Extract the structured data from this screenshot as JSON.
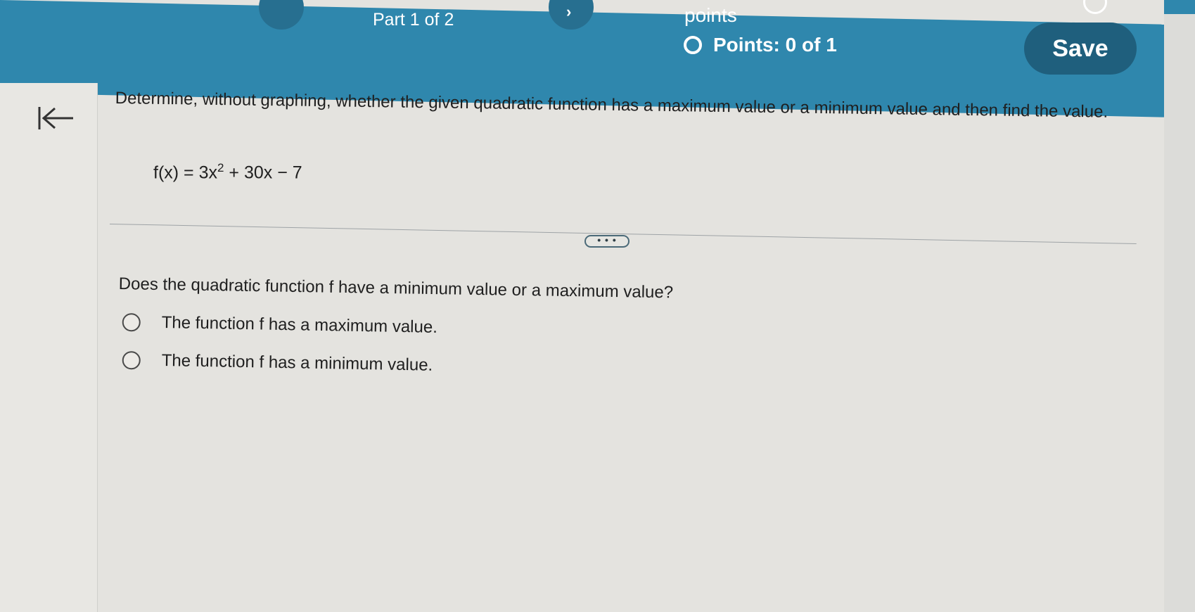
{
  "header": {
    "part_label": "Part 1 of 2",
    "next_icon": "chevron-right",
    "points_word": "points",
    "points_status": "Points: 0 of 1",
    "save_label": "Save"
  },
  "nav": {
    "back_icon": "arrow-left-to-bar"
  },
  "problem": {
    "prompt": "Determine, without graphing, whether the given quadratic function has a maximum value or a minimum value and then find the value.",
    "function_prefix": "f(x) = 3x",
    "function_exponent": "2",
    "function_suffix": " + 30x − 7",
    "more_label": "• • •"
  },
  "part1": {
    "question": "Does the quadratic function f have a minimum value or a maximum value?",
    "options": [
      {
        "label": "The function f has a maximum value."
      },
      {
        "label": "The function f has a minimum value."
      }
    ]
  },
  "colors": {
    "header": "#2f87ad",
    "save_button": "#1f5f7d",
    "background": "#e4e3df"
  }
}
